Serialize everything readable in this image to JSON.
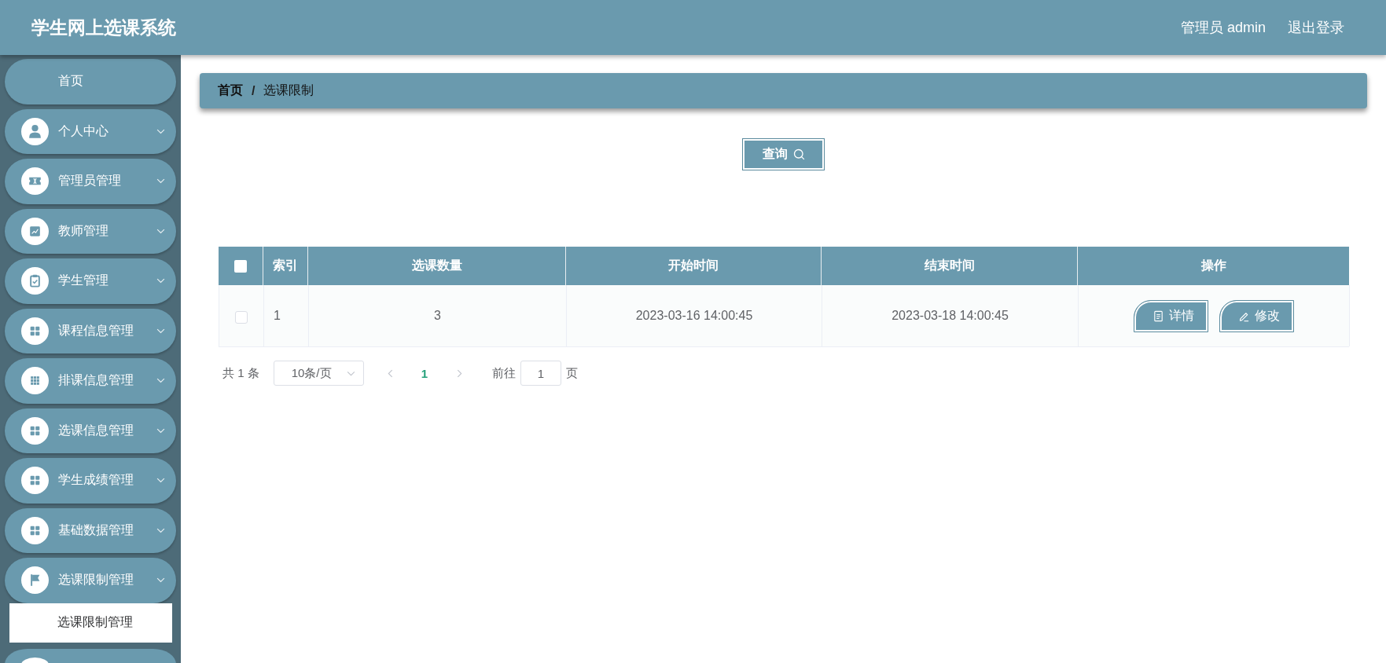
{
  "header": {
    "title": "学生网上选课系统",
    "user": "管理员 admin",
    "logout": "退出登录"
  },
  "sidebar": {
    "items": [
      {
        "kind": "link",
        "label": "首页"
      },
      {
        "kind": "menu",
        "label": "个人中心"
      },
      {
        "kind": "menu",
        "label": "管理员管理"
      },
      {
        "kind": "menu",
        "label": "教师管理"
      },
      {
        "kind": "menu",
        "label": "学生管理"
      },
      {
        "kind": "menu",
        "label": "课程信息管理"
      },
      {
        "kind": "menu",
        "label": "排课信息管理"
      },
      {
        "kind": "menu",
        "label": "选课信息管理"
      },
      {
        "kind": "menu",
        "label": "学生成绩管理"
      },
      {
        "kind": "menu",
        "label": "基础数据管理"
      },
      {
        "kind": "menu",
        "label": "选课限制管理",
        "children": [
          {
            "label": "选课限制管理",
            "selected": true
          }
        ]
      }
    ]
  },
  "breadcrumb": {
    "separator": "/",
    "items": [
      {
        "label": "首页",
        "current": false
      },
      {
        "label": "选课限制",
        "current": true
      }
    ]
  },
  "toolbar": {
    "search_button": "查询"
  },
  "table": {
    "select_all": false,
    "columns": [
      "索引",
      "选课数量",
      "开始时间",
      "结束时间",
      "操作"
    ],
    "rows": [
      {
        "checked": false,
        "cells": [
          "1",
          "3",
          "2023-03-16 14:00:45",
          "2023-03-18 14:00:45"
        ],
        "actions": [
          "详情",
          "修改"
        ]
      }
    ]
  },
  "pagination": {
    "total": "共 1 条",
    "page_size": "10条/页",
    "prev_disabled": true,
    "pages": [
      {
        "label": "1",
        "selected": true
      }
    ],
    "next_disabled": true,
    "goto_label": "前往",
    "goto_value": "1",
    "goto_suffix": "页"
  }
}
